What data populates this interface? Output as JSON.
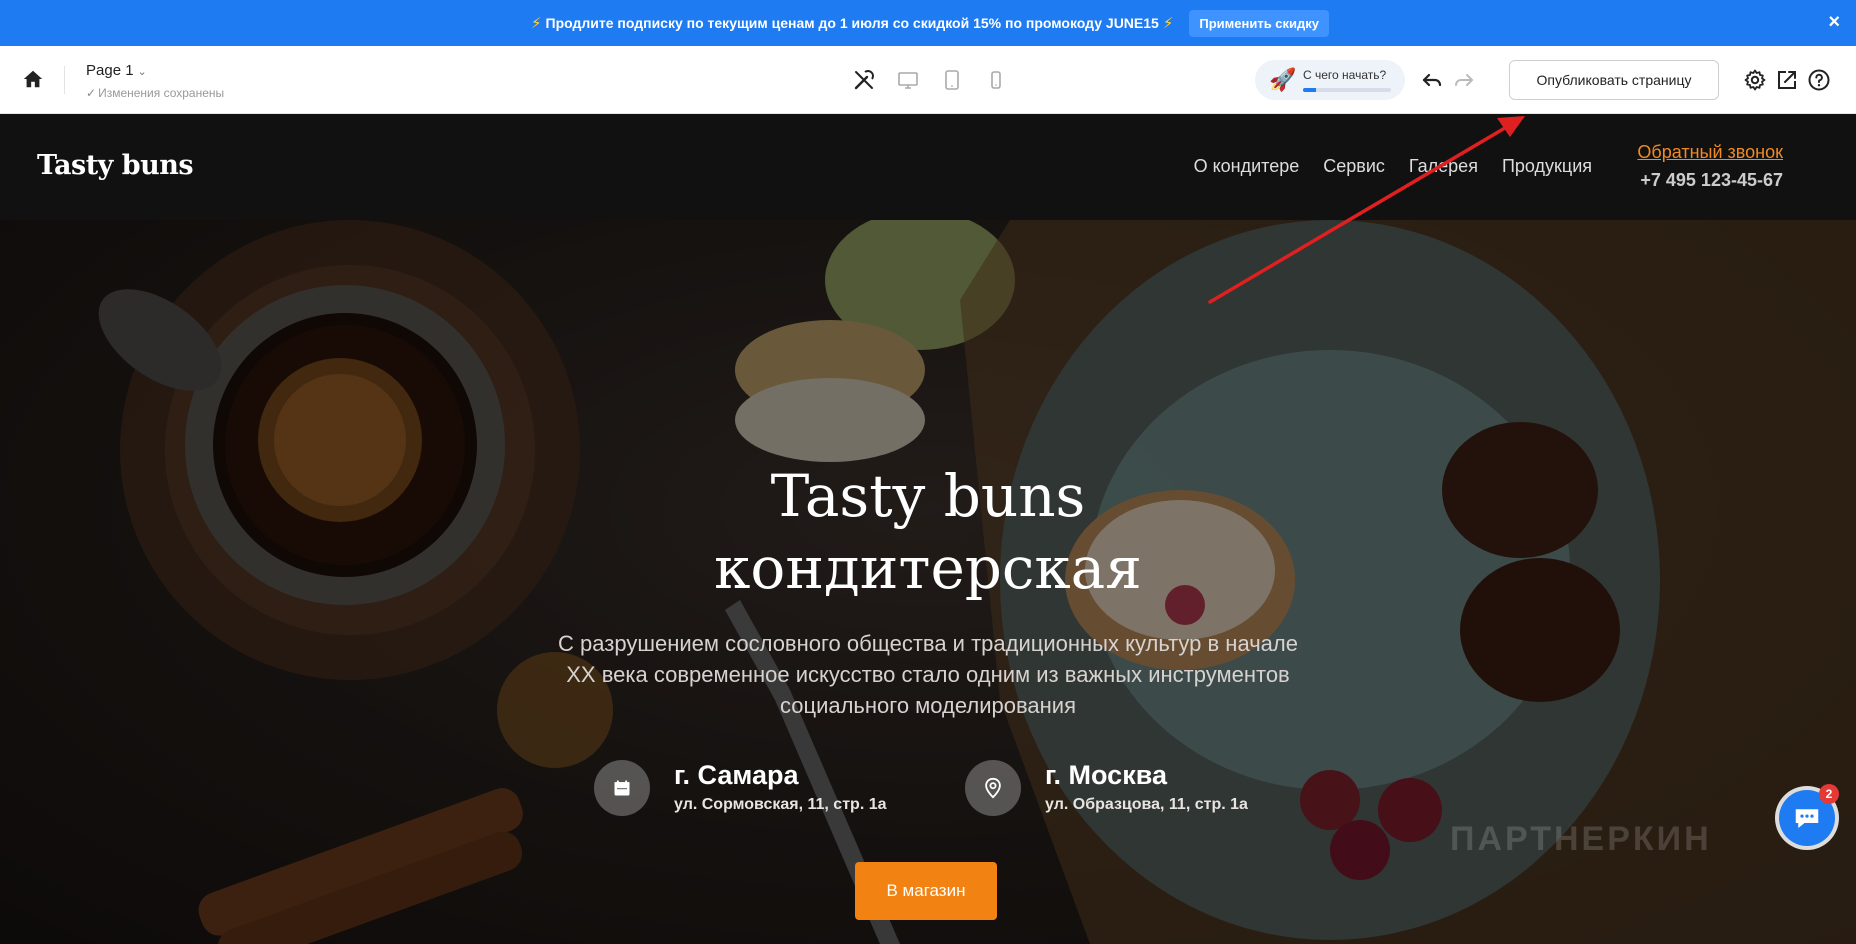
{
  "promo": {
    "text": "Продлите подписку по текущим ценам до 1 июля со скидкой 15% по промокоду JUNE15",
    "apply_label": "Применить скидку",
    "close_label": "×"
  },
  "editor": {
    "page_title": "Page 1",
    "save_status": "Изменения сохранены",
    "start_label": "С чего начать?",
    "start_progress": 0.15,
    "publish_label": "Опубликовать страницу"
  },
  "site": {
    "logo": "Tasty buns",
    "nav": [
      "О кондитере",
      "Сервис",
      "Галерея",
      "Продукция"
    ],
    "callback": "Обратный звонок",
    "phone": "+7 495 123-45-67"
  },
  "hero": {
    "title_line1": "Tasty buns",
    "title_line2": "кондитерская",
    "text": "С разрушением сословного общества и традиционных культур в начале XX века современное искусство стало одним из важных инструментов социального моделирования",
    "locations": [
      {
        "city": "г. Самара",
        "address": "ул. Сормовская, 11, стр. 1а",
        "icon": "calendar-icon"
      },
      {
        "city": "г. Москва",
        "address": "ул. Образцова, 11, стр. 1а",
        "icon": "map-pin-icon"
      }
    ],
    "shop_button": "В магазин",
    "watermark": "ПАРТНЕРКИН"
  },
  "chat": {
    "badge_count": "2"
  },
  "colors": {
    "promo_bg": "#1e7bf2",
    "accent_orange": "#f28312",
    "callback_link": "#f08a24",
    "header_bg": "#111111",
    "arrow_red": "#e02020"
  },
  "icons": [
    "home-icon",
    "magic-wand-icon",
    "desktop-icon",
    "tablet-icon",
    "mobile-icon",
    "rocket-icon",
    "undo-icon",
    "redo-icon",
    "gear-icon",
    "external-link-icon",
    "help-icon",
    "chat-icon"
  ]
}
